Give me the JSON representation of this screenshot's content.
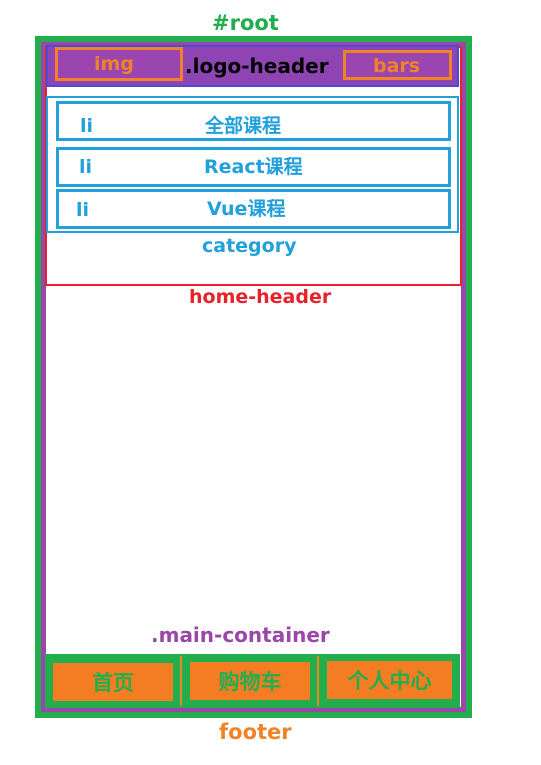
{
  "root": {
    "label": "#root"
  },
  "main_container": {
    "label": ".main-container"
  },
  "home_header": {
    "label": "home-header"
  },
  "logo_header": {
    "label": ".logo-header",
    "img_label": "img",
    "bars_label": "bars"
  },
  "category": {
    "label": "category",
    "items": [
      {
        "tag": "li",
        "text": "全部课程"
      },
      {
        "tag": "li",
        "text": "React课程"
      },
      {
        "tag": "li",
        "text": "Vue课程"
      }
    ]
  },
  "footer": {
    "label": "footer",
    "tabs": [
      {
        "label": "首页"
      },
      {
        "label": "购物车"
      },
      {
        "label": "个人中心"
      }
    ]
  },
  "colors": {
    "root": "#22ae4c",
    "main_container": "#9b47a9",
    "home_header": "#e8222a",
    "category": "#22a0dc",
    "orange": "#f08228"
  }
}
